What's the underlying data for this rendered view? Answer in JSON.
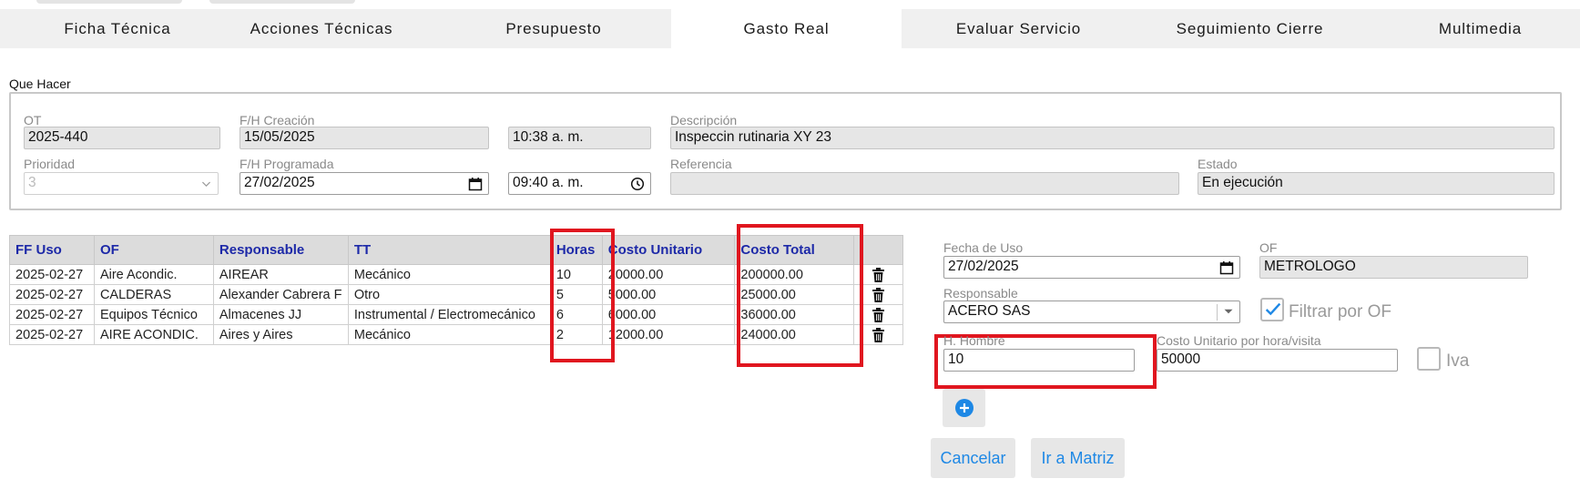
{
  "tabs": [
    {
      "label": "Ficha Técnica"
    },
    {
      "label": "Acciones Técnicas"
    },
    {
      "label": "Presupuesto"
    },
    {
      "label": "Gasto Real"
    },
    {
      "label": "Evaluar Servicio"
    },
    {
      "label": "Seguimiento Cierre"
    },
    {
      "label": "Multimedia"
    }
  ],
  "active_tab": "Gasto Real",
  "que_hacer": {
    "legend": "Que Hacer",
    "ot": {
      "label": "OT",
      "value": "2025-440"
    },
    "fh_creacion": {
      "label": "F/H Creación",
      "date": "15/05/2025",
      "time": "10:38 a. m."
    },
    "descripcion": {
      "label": "Descripción",
      "value": "Inspeccin rutinaria XY 23"
    },
    "prioridad": {
      "label": "Prioridad",
      "value": "3"
    },
    "fh_programada": {
      "label": "F/H Programada",
      "date": "27/02/2025",
      "time": "09:40 a. m."
    },
    "referencia": {
      "label": "Referencia",
      "value": ""
    },
    "estado": {
      "label": "Estado",
      "value": "En ejecución"
    }
  },
  "table": {
    "headers": [
      "FF Uso",
      "OF",
      "Responsable",
      "TT",
      "Horas",
      "Costo Unitario",
      "Costo Total"
    ],
    "rows": [
      {
        "ff_uso": "2025-02-27",
        "of": "Aire Acondic.",
        "responsable": "AIREAR",
        "tt": "Mecánico",
        "horas": "10",
        "costo_unitario": "20000.00",
        "costo_total": "200000.00"
      },
      {
        "ff_uso": "2025-02-27",
        "of": "CALDERAS",
        "responsable": "Alexander Cabrera F",
        "tt": "Otro",
        "horas": "5",
        "costo_unitario": "5000.00",
        "costo_total": "25000.00"
      },
      {
        "ff_uso": "2025-02-27",
        "of": "Equipos Técnico",
        "responsable": "Almacenes JJ",
        "tt": "Instrumental / Electromecánico",
        "horas": "6",
        "costo_unitario": "6000.00",
        "costo_total": "36000.00"
      },
      {
        "ff_uso": "2025-02-27",
        "of": "AIRE ACONDIC.",
        "responsable": "Aires y Aires",
        "tt": "Mecánico",
        "horas": "2",
        "costo_unitario": "12000.00",
        "costo_total": "24000.00"
      }
    ]
  },
  "form": {
    "fecha_uso": {
      "label": "Fecha de Uso",
      "value": "27/02/2025"
    },
    "of": {
      "label": "OF",
      "value": "METROLOGO"
    },
    "responsable": {
      "label": "Responsable",
      "value": "ACERO SAS"
    },
    "filtrar_por_of": {
      "label": "Filtrar por OF",
      "checked": true
    },
    "h_hombre": {
      "label": "H. Hombre",
      "value": "10"
    },
    "costo_unitario": {
      "label": "Costo Unitario por hora/visita",
      "value": "50000"
    },
    "iva": {
      "label": "Iva",
      "checked": false
    },
    "cancel_label": "Cancelar",
    "matrix_label": "Ir a Matriz"
  },
  "colors": {
    "accent": "#1e88e5",
    "header_text": "#1d29a8",
    "highlight": "#e0161f"
  },
  "icons": [
    "calendar-icon",
    "clock-icon",
    "chevron-down-icon",
    "trash-icon",
    "plus-circle-icon",
    "checkmark-icon"
  ]
}
